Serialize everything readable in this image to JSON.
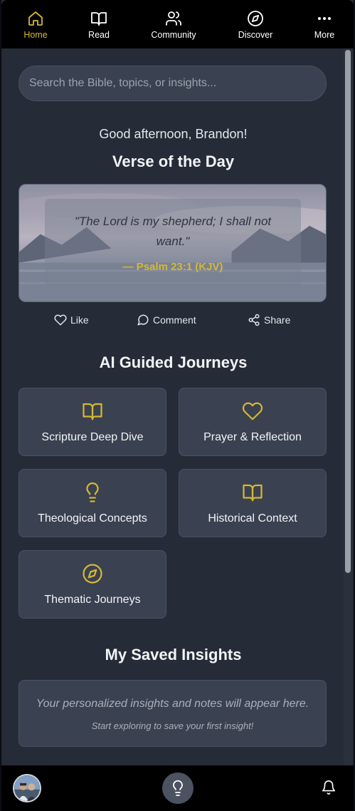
{
  "nav": {
    "items": [
      {
        "label": "Home",
        "icon": "home-icon",
        "active": true
      },
      {
        "label": "Read",
        "icon": "book-icon",
        "active": false
      },
      {
        "label": "Community",
        "icon": "users-icon",
        "active": false
      },
      {
        "label": "Discover",
        "icon": "compass-icon",
        "active": false
      },
      {
        "label": "More",
        "icon": "more-dots-icon",
        "active": false
      }
    ]
  },
  "search": {
    "placeholder": "Search the Bible, topics, or insights...",
    "value": ""
  },
  "greeting": "Good afternoon, Brandon!",
  "votd": {
    "title": "Verse of the Day",
    "text": "\"The Lord is my shepherd; I shall not want.\"",
    "reference": "— Psalm 23:1 (KJV)"
  },
  "actions": {
    "like": "Like",
    "comment": "Comment",
    "share": "Share"
  },
  "journeys": {
    "title": "AI Guided Journeys",
    "items": [
      {
        "label": "Scripture Deep Dive",
        "icon": "book-open-icon"
      },
      {
        "label": "Prayer & Reflection",
        "icon": "heart-icon"
      },
      {
        "label": "Theological Concepts",
        "icon": "lightbulb-icon"
      },
      {
        "label": "Historical Context",
        "icon": "book-open-icon"
      },
      {
        "label": "Thematic Journeys",
        "icon": "compass-icon"
      }
    ]
  },
  "saved": {
    "title": "My Saved Insights",
    "empty_main": "Your personalized insights and notes will appear here.",
    "empty_sub": "Start exploring to save your first insight!"
  },
  "bottom": {
    "avatar_icon": "user-avatar",
    "center_icon": "lightbulb-icon",
    "right_icon": "bell-icon"
  },
  "colors": {
    "accent": "#d4b735",
    "background": "#252b37",
    "card": "#3a4150",
    "nav": "#000000"
  }
}
